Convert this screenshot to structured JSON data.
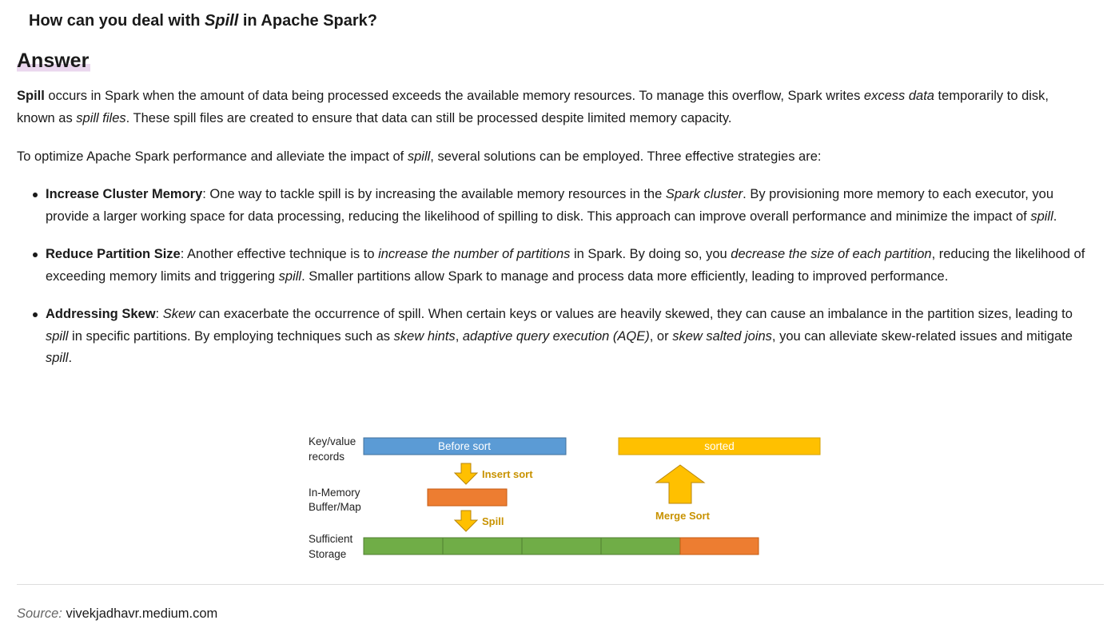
{
  "question": {
    "before": "How can you deal with ",
    "emphasis": "Spill",
    "after": " in Apache Spark?"
  },
  "answer_heading": "Answer",
  "paragraph1": {
    "term": "Spill",
    "t1": " occurs in Spark when the amount of data being processed exceeds the available memory resources. To manage this overflow, Spark writes ",
    "i1": "excess data",
    "t2": " temporarily to disk, known as ",
    "i2": "spill files",
    "t3": ". These spill files are created to ensure that data can still be processed despite limited memory capacity."
  },
  "paragraph2": {
    "t1": "To optimize Apache Spark performance and alleviate the impact of ",
    "i1": "spill",
    "t2": ", several solutions can be employed. Three effective strategies are:"
  },
  "strategies": [
    {
      "title": "Increase Cluster Memory",
      "t1": ": One way to tackle spill is by increasing the available memory resources in the ",
      "i1": "Spark cluster",
      "t2": ". By provisioning more memory to each executor, you provide a larger working space for data processing, reducing the likelihood of spilling to disk. This approach can improve overall performance and minimize the impact of ",
      "i2": "spill",
      "t3": "."
    },
    {
      "title": "Reduce Partition Size",
      "t1": ": Another effective technique is to ",
      "i1": "increase the number of partitions",
      "t2": " in Spark. By doing so, you ",
      "i2": "decrease the size of each partition",
      "t3": ", reducing the likelihood of exceeding memory limits and triggering ",
      "i3": "spill",
      "t4": ". Smaller partitions allow Spark to manage and process data more efficiently, leading to improved performance."
    },
    {
      "title": "Addressing Skew",
      "t1": ": ",
      "i1": "Skew",
      "t2": " can exacerbate the occurrence of spill. When certain keys or values are heavily skewed, they can cause an imbalance in the partition sizes, leading to ",
      "i2": "spill",
      "t3": " in specific partitions. By employing techniques such as ",
      "i3": "skew hints",
      "t4": ", ",
      "i4": "adaptive query execution (AQE)",
      "t5": ", or ",
      "i5": "skew salted joins",
      "t6": ", you can alleviate skew-related issues and mitigate ",
      "i6": "spill",
      "t7": "."
    }
  ],
  "diagram": {
    "row1_label": [
      "Key/value",
      "records"
    ],
    "row2_label": [
      "In-Memory",
      "Buffer/Map"
    ],
    "row3_label": [
      "Sufficient",
      "Storage"
    ],
    "before_sort": "Before sort",
    "sorted": "sorted",
    "insert_sort": "Insert sort",
    "spill": "Spill",
    "merge_sort": "Merge Sort",
    "colors": {
      "blue": "#5b9bd5",
      "gold": "#ffc000",
      "orange": "#ed7d31",
      "green": "#70ad47",
      "label_gold": "#c89200"
    }
  },
  "source": {
    "label": "Source:",
    "value": "vivekjadhavr.medium.com"
  }
}
